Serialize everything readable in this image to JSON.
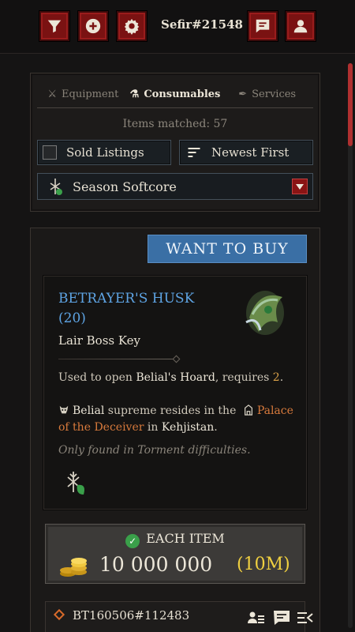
{
  "header": {
    "username": "Sefir#21548",
    "buttons": [
      {
        "name": "filter-icon"
      },
      {
        "name": "plus-icon"
      },
      {
        "name": "gear-icon"
      },
      {
        "name": "chat-icon"
      },
      {
        "name": "profile-icon"
      }
    ]
  },
  "filters": {
    "tabs": [
      {
        "label": "Equipment",
        "icon": "swords-icon",
        "active": false
      },
      {
        "label": "Consumables",
        "icon": "potion-icon",
        "active": true
      },
      {
        "label": "Services",
        "icon": "feather-icon",
        "active": false
      }
    ],
    "items_matched": "Items matched: 57",
    "sold_listings_label": "Sold Listings",
    "sort_label": "Newest First",
    "season_label": "Season Softcore"
  },
  "listing": {
    "badge": "WANT TO BUY",
    "item": {
      "name": "BETRAYER'S HUSK",
      "quantity": "(20)",
      "type": "Lair Boss Key",
      "desc_prefix": "Used to open ",
      "desc_target": "Belial's Hoard",
      "desc_mid": ", requires ",
      "desc_num": "2",
      "desc_end": ".",
      "boss_name": "Belial",
      "boss_text": " supreme resides in the ",
      "boss_location": "Palace of the Deceiver",
      "boss_in": " in ",
      "boss_region": "Kehjistan",
      "boss_end": ".",
      "found_text": "Only found in Torment difficulties."
    },
    "price": {
      "label": "EACH ITEM",
      "value": "10 000 000",
      "short": "(10M)"
    },
    "trade": {
      "id": "BT160506#112483"
    }
  },
  "colors": {
    "accent_red": "#7a1212",
    "item_blue": "#5ea4e4",
    "badge_blue": "#3a6fa5",
    "gold": "#f0d040",
    "location_orange": "#d87a3c"
  }
}
